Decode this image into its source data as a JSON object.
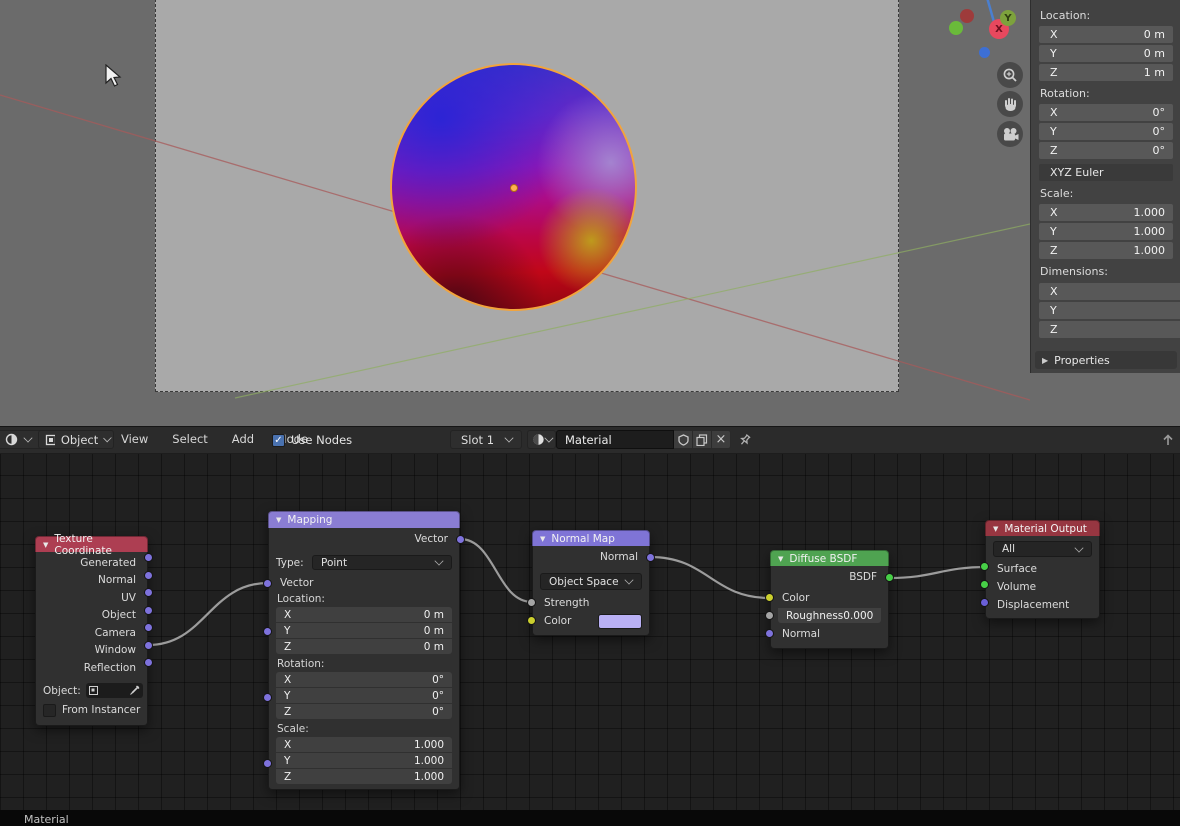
{
  "glyphs": {
    "collapse": "▼",
    "collapsed": "▶",
    "check": "✓",
    "close": "×"
  },
  "colors": {
    "header_texture_coordinate": "#ad3e52",
    "header_mapping": "#8a7dd3",
    "header_normal_map": "#7f74d6",
    "header_diffuse_bsdf": "#4fa351",
    "header_material_output": "#973641",
    "socket_vector": "#7e72dc",
    "socket_shader": "#47cf47",
    "socket_color": "#cbcf2e",
    "socket_value": "#a5a5a5",
    "socket_displacement": "#6a5fd8",
    "normal_map_color_swatch": "#b9b0f4",
    "checkbox_accent": "#4a72b0",
    "selection_outline": "#f2a43c"
  },
  "gizmo": {
    "x_label": "X",
    "y_label": "Y"
  },
  "sidebar": {
    "location_label": "Location:",
    "location_rows": [
      {
        "axis": "X",
        "value": "0 m"
      },
      {
        "axis": "Y",
        "value": "0 m"
      },
      {
        "axis": "Z",
        "value": "1 m"
      }
    ],
    "rotation_label": "Rotation:",
    "rotation_rows": [
      {
        "axis": "X",
        "value": "0°"
      },
      {
        "axis": "Y",
        "value": "0°"
      },
      {
        "axis": "Z",
        "value": "0°"
      }
    ],
    "rotation_mode": "XYZ Euler",
    "scale_label": "Scale:",
    "scale_rows": [
      {
        "axis": "X",
        "value": "1.000"
      },
      {
        "axis": "Y",
        "value": "1.000"
      },
      {
        "axis": "Z",
        "value": "1.000"
      }
    ],
    "dimensions_label": "Dimensions:",
    "dimension_rows": [
      {
        "axis": "X",
        "value": ""
      },
      {
        "axis": "Y",
        "value": ""
      },
      {
        "axis": "Z",
        "value": ""
      }
    ],
    "properties_label": "Properties"
  },
  "editor_header": {
    "object_type": "Object",
    "menus": [
      "View",
      "Select",
      "Add",
      "Node"
    ],
    "use_nodes_label": "Use Nodes",
    "slot": "Slot 1",
    "material_name": "Material"
  },
  "status_path": "Material",
  "nodes": {
    "texture_coordinate": {
      "title": "Texture Coordinate",
      "outputs": [
        "Generated",
        "Normal",
        "UV",
        "Object",
        "Camera",
        "Window",
        "Reflection"
      ],
      "object_label": "Object:",
      "from_instancer_label": "From Instancer"
    },
    "mapping": {
      "title": "Mapping",
      "output": "Vector",
      "type_label": "Type:",
      "type_value": "Point",
      "vector_input": "Vector",
      "location_label": "Location:",
      "location_rows": [
        {
          "axis": "X",
          "value": "0 m"
        },
        {
          "axis": "Y",
          "value": "0 m"
        },
        {
          "axis": "Z",
          "value": "0 m"
        }
      ],
      "rotation_label": "Rotation:",
      "rotation_rows": [
        {
          "axis": "X",
          "value": "0°"
        },
        {
          "axis": "Y",
          "value": "0°"
        },
        {
          "axis": "Z",
          "value": "0°"
        }
      ],
      "scale_label": "Scale:",
      "scale_rows": [
        {
          "axis": "X",
          "value": "1.000"
        },
        {
          "axis": "Y",
          "value": "1.000"
        },
        {
          "axis": "Z",
          "value": "1.000"
        }
      ]
    },
    "normal_map": {
      "title": "Normal Map",
      "output": "Normal",
      "space": "Object Space",
      "strength_label": "Strength",
      "color_label": "Color"
    },
    "diffuse_bsdf": {
      "title": "Diffuse BSDF",
      "output": "BSDF",
      "color_label": "Color",
      "roughness_label": "Roughness",
      "roughness_value": "0.000",
      "normal_label": "Normal"
    },
    "material_output": {
      "title": "Material Output",
      "target": "All",
      "inputs": [
        "Surface",
        "Volume",
        "Displacement"
      ]
    }
  }
}
